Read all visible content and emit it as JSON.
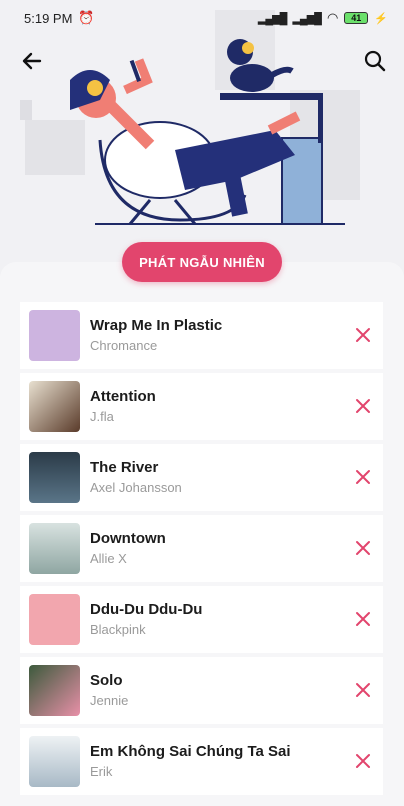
{
  "status_bar": {
    "time": "5:19 PM",
    "battery": "41"
  },
  "header": {
    "back_icon": "arrow-left-icon",
    "search_icon": "search-icon"
  },
  "shuffle_button": {
    "label": "PHÁT NGẪU NHIÊN"
  },
  "songs": [
    {
      "title": "Wrap Me In Plastic",
      "artist": "Chromance",
      "thumb_color": "#cdb4e0"
    },
    {
      "title": "Attention",
      "artist": "J.fla",
      "thumb_color": "#8a6a50"
    },
    {
      "title": "The River",
      "artist": "Axel Johansson",
      "thumb_color": "#3d5566"
    },
    {
      "title": "Downtown",
      "artist": "Allie X",
      "thumb_color": "#b7c7c4"
    },
    {
      "title": "Ddu-Du Ddu-Du",
      "artist": "Blackpink",
      "thumb_color": "#f2a6ae"
    },
    {
      "title": "Solo",
      "artist": "Jennie",
      "thumb_color": "#6e8a6e"
    },
    {
      "title": "Em Không Sai Chúng Ta Sai",
      "artist": "Erik",
      "thumb_color": "#a8b9c6"
    }
  ],
  "colors": {
    "accent": "#e2456d",
    "remove_icon": "#e2456d"
  }
}
